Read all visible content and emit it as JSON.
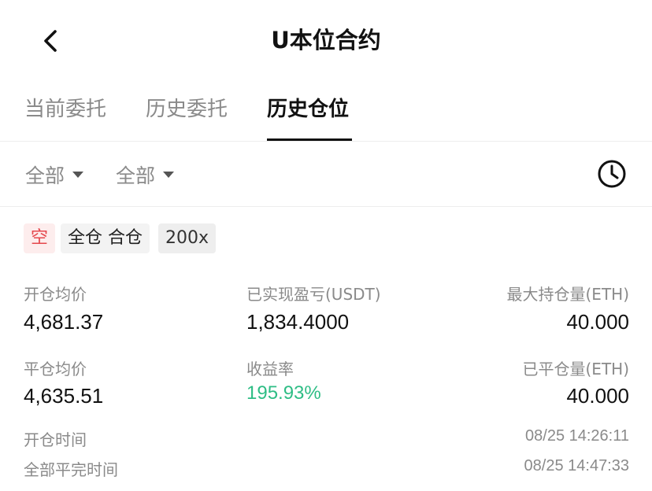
{
  "header": {
    "title": "U本位合约"
  },
  "tabs": [
    {
      "label": "当前委托"
    },
    {
      "label": "历史委托"
    },
    {
      "label": "历史仓位"
    }
  ],
  "active_tab": "历史仓位",
  "filters": [
    {
      "label": "全部"
    },
    {
      "label": "全部"
    }
  ],
  "position": {
    "tags": {
      "side": "空",
      "mode": "全仓 合仓",
      "leverage": "200x"
    },
    "colors": {
      "short_tag_text": "#e5484d",
      "short_tag_bg": "#fdeded",
      "positive": "#2ebd85"
    },
    "open_avg_price": {
      "label": "开仓均价",
      "value": "4,681.37"
    },
    "realized_pnl": {
      "label": "已实现盈亏(USDT)",
      "value": "1,834.4000"
    },
    "max_holding": {
      "label": "最大持仓量(ETH)",
      "value": "40.000"
    },
    "close_avg_price": {
      "label": "平仓均价",
      "value": "4,635.51"
    },
    "roi": {
      "label": "收益率",
      "value": "195.93%"
    },
    "closed_qty": {
      "label": "已平仓量(ETH)",
      "value": "40.000"
    },
    "open_time": {
      "label": "开仓时间",
      "value": "08/25 14:26:11"
    },
    "close_time": {
      "label": "全部平完时间",
      "value": "08/25 14:47:33"
    }
  },
  "icons": {
    "back": "chevron-left-icon",
    "history": "clock-icon"
  }
}
